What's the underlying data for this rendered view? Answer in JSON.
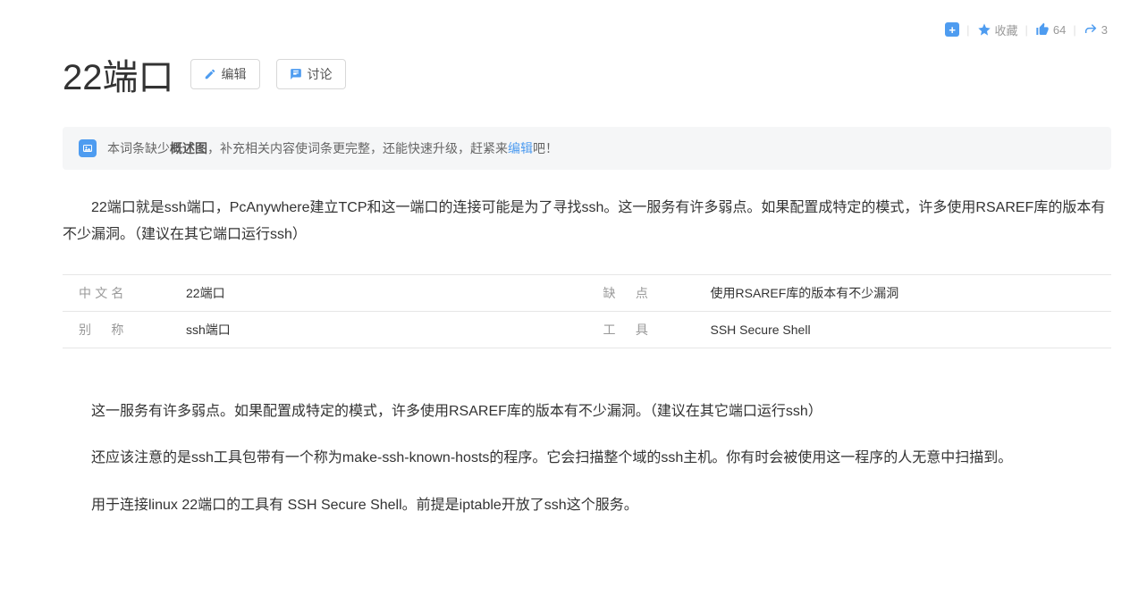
{
  "topbar": {
    "favorite_label": "收藏",
    "like_count": "64",
    "share_count": "3"
  },
  "title": "22端口",
  "buttons": {
    "edit": "编辑",
    "discuss": "讨论"
  },
  "notice": {
    "prefix": "本词条缺少",
    "bold": "概述图",
    "middle": "，补充相关内容使词条更完整，还能快速升级，赶紧来",
    "link": "编辑",
    "suffix": "吧！"
  },
  "intro": "22端口就是ssh端口，PcAnywhere建立TCP和这一端口的连接可能是为了寻找ssh。这一服务有许多弱点。如果配置成特定的模式，许多使用RSAREF库的版本有不少漏洞。（建议在其它端口运行ssh）",
  "info": {
    "row1": {
      "left_label": "中文名",
      "left_value": "22端口",
      "right_label": "缺　点",
      "right_value": "使用RSAREF库的版本有不少漏洞"
    },
    "row2": {
      "left_label": "别　称",
      "left_value": "ssh端口",
      "right_label": "工　具",
      "right_value": "SSH Secure Shell"
    }
  },
  "body": {
    "p1": "这一服务有许多弱点。如果配置成特定的模式，许多使用RSAREF库的版本有不少漏洞。（建议在其它端口运行ssh）",
    "p2": "还应该注意的是ssh工具包带有一个称为make-ssh-known-hosts的程序。它会扫描整个域的ssh主机。你有时会被使用这一程序的人无意中扫描到。",
    "p3": "用于连接linux 22端口的工具有 SSH Secure Shell。前提是iptable开放了ssh这个服务。"
  }
}
